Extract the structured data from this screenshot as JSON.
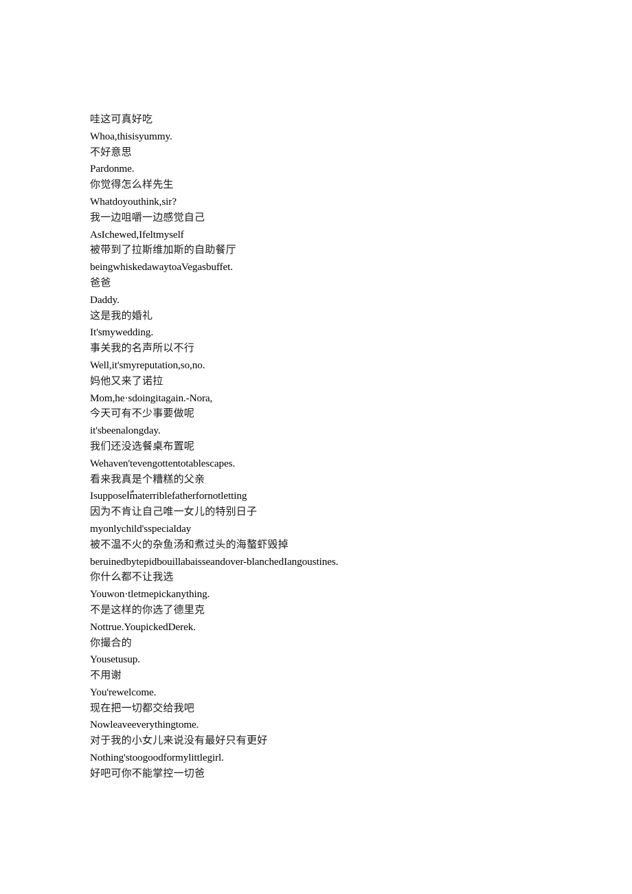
{
  "document": {
    "type": "bilingual-subtitle-transcript",
    "background_color": "#ffffff",
    "text_color": "#000000",
    "lines": [
      {
        "lang": "zh",
        "text": "哇这可真好吃"
      },
      {
        "lang": "en",
        "text": "Whoa,thisisyummy."
      },
      {
        "lang": "zh",
        "text": "不好意思"
      },
      {
        "lang": "en",
        "text": "Pardonme."
      },
      {
        "lang": "zh",
        "text": "你觉得怎么样先生"
      },
      {
        "lang": "en",
        "text": "Whatdoyouthink,sir?"
      },
      {
        "lang": "zh",
        "text": "我一边咀嚼一边感觉自己"
      },
      {
        "lang": "en",
        "text": "AsIchewed,Ifeltmyself"
      },
      {
        "lang": "zh",
        "text": "被带到了拉斯维加斯的自助餐厅"
      },
      {
        "lang": "en",
        "text": "beingwhiskedawaytoaVegasbuffet."
      },
      {
        "lang": "zh",
        "text": "爸爸"
      },
      {
        "lang": "en",
        "text": "Daddy."
      },
      {
        "lang": "zh",
        "text": "这是我的婚礼"
      },
      {
        "lang": "en",
        "text": "It'smywedding."
      },
      {
        "lang": "zh",
        "text": "事关我的名声所以不行"
      },
      {
        "lang": "en",
        "text": "Well,it'smyreputation,so,no."
      },
      {
        "lang": "zh",
        "text": "妈他又来了诺拉"
      },
      {
        "lang": "en",
        "text": "Mom,he·sdoingitagain.-Nora,"
      },
      {
        "lang": "zh",
        "text": "今天可有不少事要做呢"
      },
      {
        "lang": "en",
        "text": "it'sbeenalongday."
      },
      {
        "lang": "zh",
        "text": "我们还没选餐桌布置呢"
      },
      {
        "lang": "en",
        "text": "Wehaven'tevengottentotablescapes."
      },
      {
        "lang": "zh",
        "text": "看来我真是个糟糕的父亲"
      },
      {
        "lang": "en",
        "text": "IsupposeIّmaterriblefatherfornotletting"
      },
      {
        "lang": "zh",
        "text": "因为不肯让自己唯一女儿的特别日子"
      },
      {
        "lang": "en",
        "text": "myonlychild'sspecialday"
      },
      {
        "lang": "zh",
        "text": "被不温不火的杂鱼汤和煮过头的海螯虾毁掉"
      },
      {
        "lang": "en",
        "text": "beruinedbytepidbouillabaisseandover-blanchedIangoustines."
      },
      {
        "lang": "zh",
        "text": "你什么都不让我选"
      },
      {
        "lang": "en",
        "text": "Youwon·tletmepickanything."
      },
      {
        "lang": "zh",
        "text": "不是这样的你选了德里克"
      },
      {
        "lang": "en",
        "text": "Nottrue.YoupickedDerek."
      },
      {
        "lang": "zh",
        "text": "你撮合的"
      },
      {
        "lang": "en",
        "text": "Yousetusup."
      },
      {
        "lang": "zh",
        "text": "不用谢"
      },
      {
        "lang": "en",
        "text": "You'rewelcome."
      },
      {
        "lang": "zh",
        "text": "现在把一切都交给我吧"
      },
      {
        "lang": "en",
        "text": "Nowleaveeverythingtome."
      },
      {
        "lang": "zh",
        "text": "对于我的小女儿来说没有最好只有更好"
      },
      {
        "lang": "en",
        "text": "Nothing'stoogoodformylittlegirl."
      },
      {
        "lang": "zh",
        "text": "好吧可你不能掌控一切爸"
      }
    ]
  }
}
